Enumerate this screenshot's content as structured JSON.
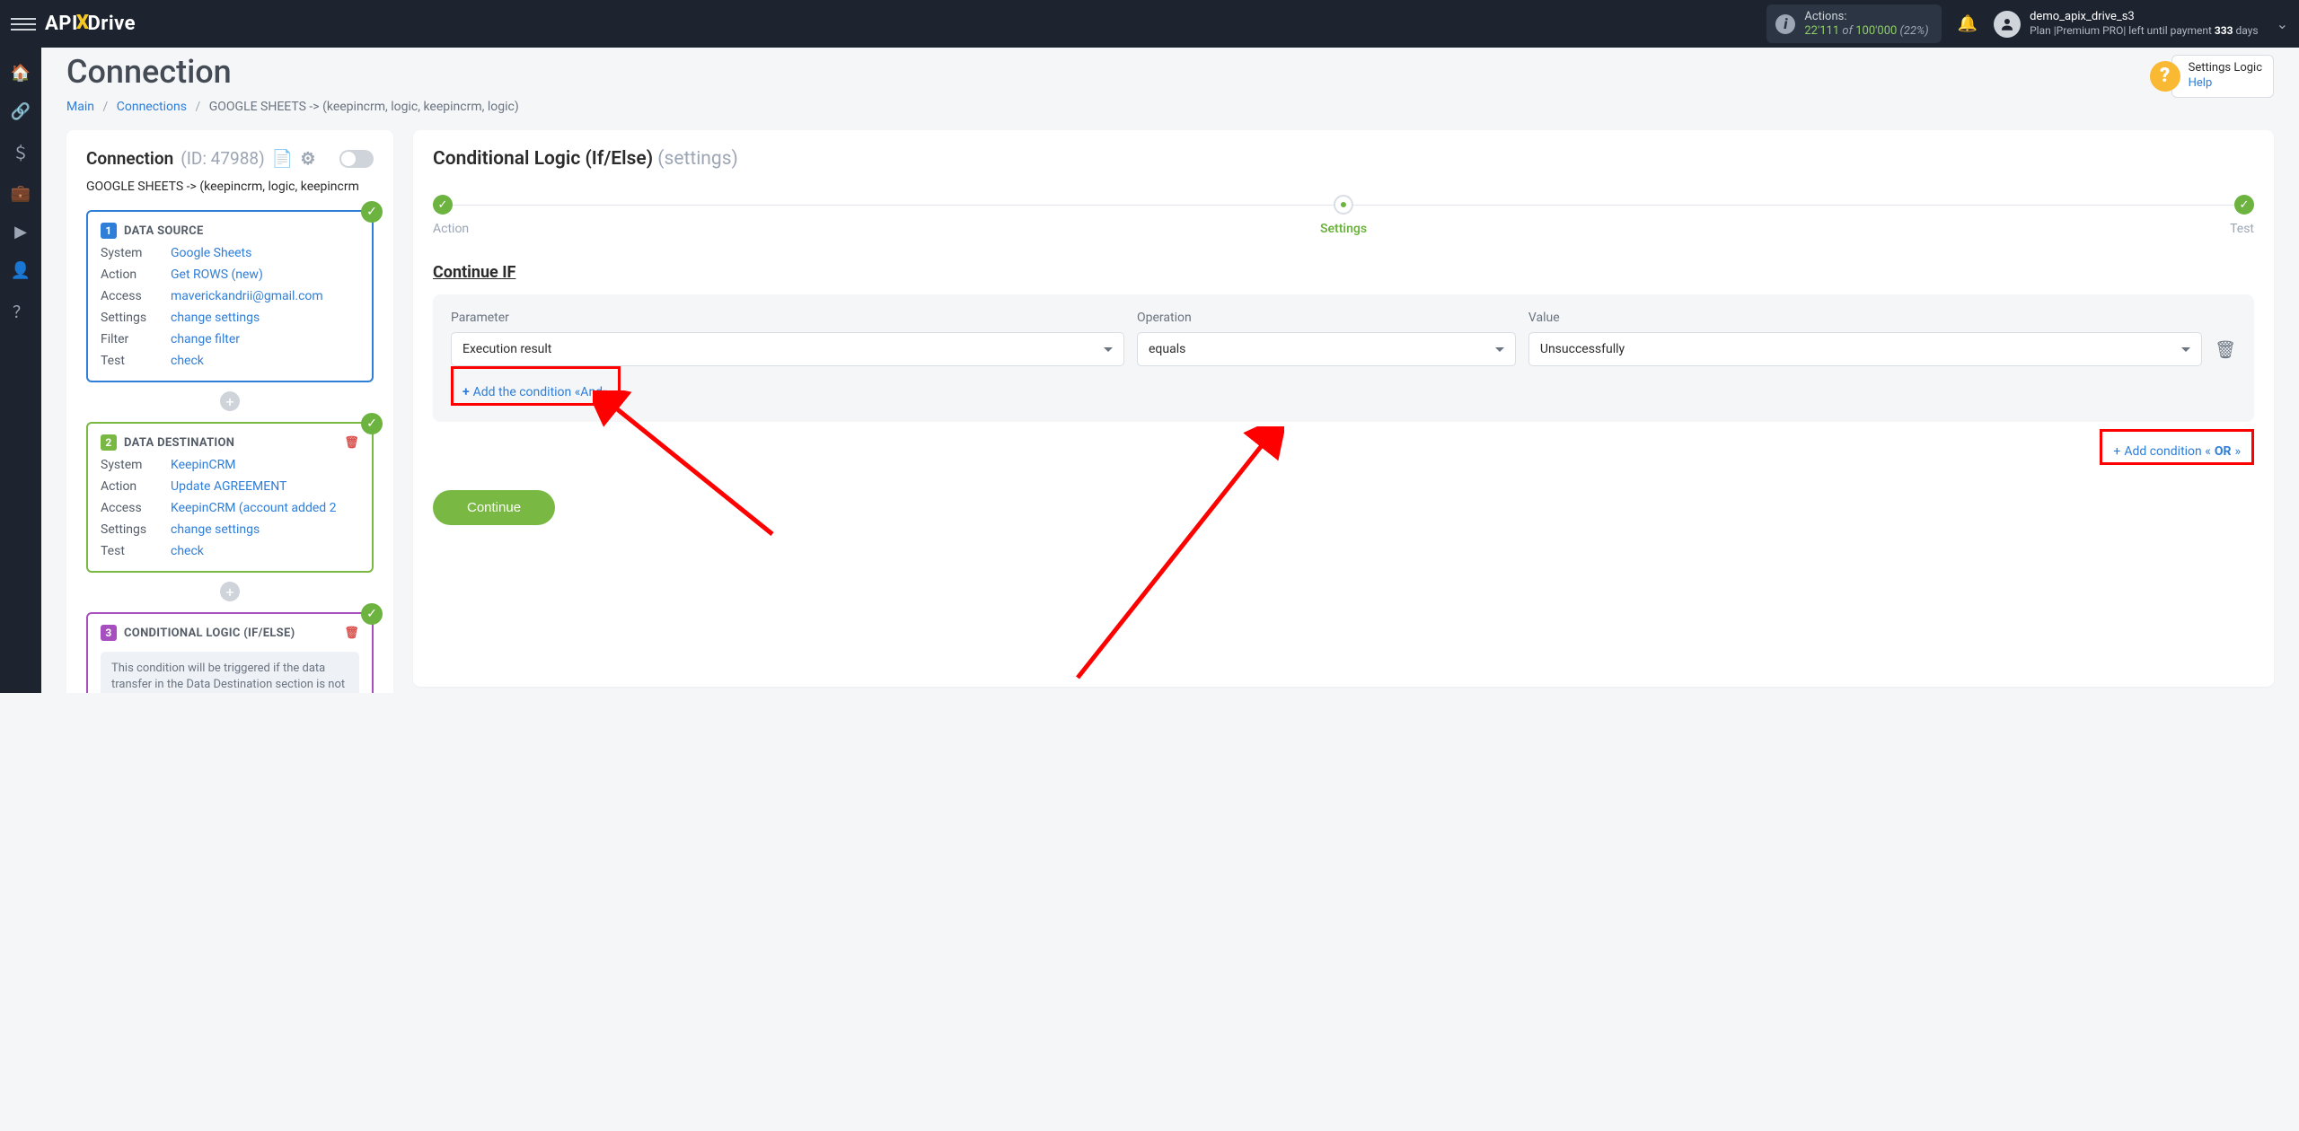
{
  "brand": {
    "api": "API",
    "x": "X",
    "drive": "Drive"
  },
  "topbar": {
    "actions_label": "Actions:",
    "actions_used": "22'111",
    "actions_of": "of",
    "actions_total": "100'000",
    "actions_pct": "(22%)",
    "user_name": "demo_apix_drive_s3",
    "plan_prefix": "Plan",
    "plan_name": "|Premium PRO|",
    "plan_left1": "left until payment",
    "plan_days_n": "333",
    "plan_days_w": "days"
  },
  "help": {
    "title": "Settings Logic",
    "link": "Help"
  },
  "page": {
    "title": "Connection",
    "breadcrumb": {
      "main": "Main",
      "conns": "Connections",
      "cur": "GOOGLE SHEETS -> (keepincrm, logic, keepincrm, logic)"
    }
  },
  "left": {
    "conn_label": "Connection",
    "conn_id": "(ID: 47988)",
    "conn_name": "GOOGLE SHEETS -> (keepincrm, logic, keepincrm",
    "src": {
      "title": "DATA SOURCE",
      "rows": [
        {
          "k": "System",
          "v": "Google Sheets"
        },
        {
          "k": "Action",
          "v": "Get ROWS (new)"
        },
        {
          "k": "Access",
          "v": "maverickandrii@gmail.com"
        },
        {
          "k": "Settings",
          "v": "change settings"
        },
        {
          "k": "Filter",
          "v": "change filter"
        },
        {
          "k": "Test",
          "v": "check"
        }
      ]
    },
    "dst": {
      "title": "DATA DESTINATION",
      "rows": [
        {
          "k": "System",
          "v": "KeepinCRM"
        },
        {
          "k": "Action",
          "v": "Update AGREEMENT"
        },
        {
          "k": "Access",
          "v": "KeepinCRM (account added 2"
        },
        {
          "k": "Settings",
          "v": "change settings"
        },
        {
          "k": "Test",
          "v": "check"
        }
      ]
    },
    "logic": {
      "title": "CONDITIONAL LOGIC (IF/ELSE)",
      "note": "This condition will be triggered if the data transfer in the Data Destination section is not successful, that is, if the agreement is"
    }
  },
  "right": {
    "title": "Conditional Logic (If/Else)",
    "title_sub": "(settings)",
    "steps": {
      "s1": "Action",
      "s2": "Settings",
      "s3": "Test"
    },
    "cont_if": "Continue IF",
    "labels": {
      "param": "Parameter",
      "op": "Operation",
      "val": "Value"
    },
    "values": {
      "param": "Execution result",
      "op": "equals",
      "val": "Unsuccessfully"
    },
    "add_and": "Add the condition «And»",
    "add_or_pre": "Add condition «",
    "add_or_b": "OR",
    "add_or_post": "»",
    "continue": "Continue"
  }
}
